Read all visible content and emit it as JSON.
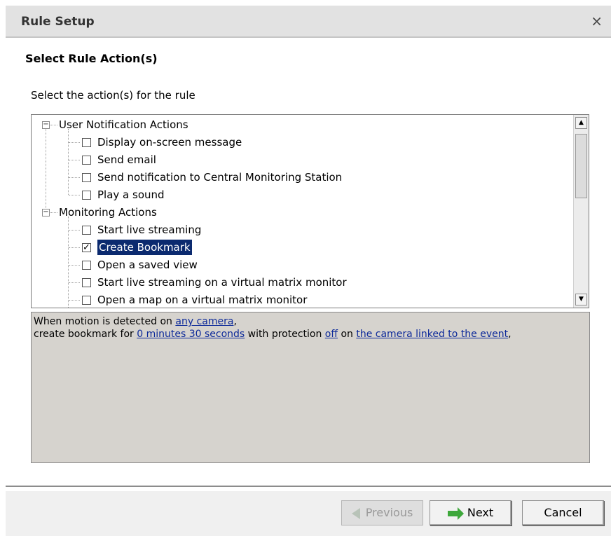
{
  "dialog": {
    "title": "Rule Setup",
    "close_glyph": "×"
  },
  "heading": "Select Rule Action(s)",
  "instruction": "Select the action(s) for the rule",
  "tree": {
    "groups": [
      {
        "label": "User Notification Actions",
        "expander": "−",
        "items": [
          {
            "label": "Display on-screen message",
            "checked": false,
            "selected": false
          },
          {
            "label": "Send email",
            "checked": false,
            "selected": false
          },
          {
            "label": "Send notification to Central Monitoring Station",
            "checked": false,
            "selected": false
          },
          {
            "label": "Play a sound",
            "checked": false,
            "selected": false
          }
        ]
      },
      {
        "label": "Monitoring Actions",
        "expander": "−",
        "items": [
          {
            "label": "Start live streaming",
            "checked": false,
            "selected": false
          },
          {
            "label": "Create Bookmark",
            "checked": true,
            "selected": true
          },
          {
            "label": "Open a saved view",
            "checked": false,
            "selected": false
          },
          {
            "label": "Start live streaming on a virtual matrix monitor",
            "checked": false,
            "selected": false
          },
          {
            "label": "Open a map on a virtual matrix monitor",
            "checked": false,
            "selected": false
          }
        ]
      }
    ],
    "scroll_up_glyph": "▲",
    "scroll_down_glyph": "▼"
  },
  "description": {
    "line1_prefix": "When motion is detected on ",
    "line1_link": "any camera",
    "line1_suffix": ",",
    "line2_prefix": "create bookmark for ",
    "duration_link": "0 minutes 30 seconds",
    "mid_text": " with protection ",
    "protection_link": "off",
    "on_text": " on ",
    "camera_link": "the camera linked to the event",
    "line2_suffix": ","
  },
  "buttons": {
    "previous": "Previous",
    "next": "Next",
    "cancel": "Cancel"
  }
}
